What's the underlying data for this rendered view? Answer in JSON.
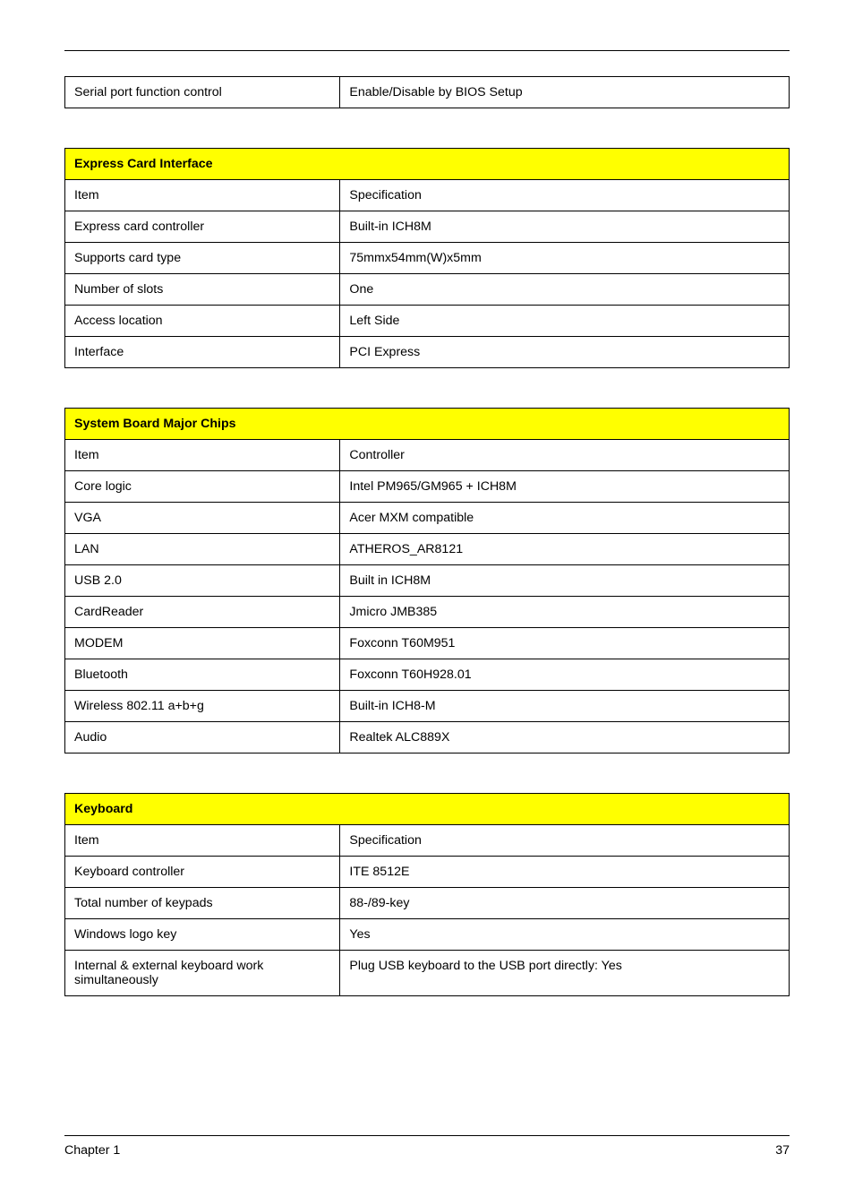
{
  "topRow": {
    "item": "Serial port function control",
    "spec": "Enable/Disable by BIOS Setup"
  },
  "tables": [
    {
      "title": "Express Card Interface",
      "headers": [
        "Item",
        "Specification"
      ],
      "rows": [
        [
          "Express card controller",
          "Built-in ICH8M"
        ],
        [
          "Supports card type",
          "75mmx54mm(W)x5mm"
        ],
        [
          "Number of slots",
          "One"
        ],
        [
          "Access location",
          "Left Side"
        ],
        [
          "Interface",
          "PCI Express"
        ]
      ]
    },
    {
      "title": "System Board Major Chips",
      "headers": [
        "Item",
        "Controller"
      ],
      "rows": [
        [
          "Core logic",
          "Intel PM965/GM965 + ICH8M"
        ],
        [
          "VGA",
          "Acer MXM compatible"
        ],
        [
          "LAN",
          "ATHEROS_AR8121"
        ],
        [
          "USB 2.0",
          "Built in ICH8M"
        ],
        [
          "CardReader",
          "Jmicro JMB385"
        ],
        [
          "MODEM",
          "Foxconn T60M951"
        ],
        [
          "Bluetooth",
          "Foxconn T60H928.01"
        ],
        [
          "Wireless 802.11 a+b+g",
          "Built-in ICH8-M"
        ],
        [
          "Audio",
          "Realtek ALC889X"
        ]
      ]
    },
    {
      "title": "Keyboard",
      "headers": [
        "Item",
        "Specification"
      ],
      "rows": [
        [
          "Keyboard controller",
          "ITE 8512E"
        ],
        [
          "Total number of keypads",
          "88-/89-key"
        ],
        [
          "Windows logo key",
          "Yes"
        ],
        [
          "Internal & external keyboard work simultaneously",
          "Plug USB keyboard to the USB port directly: Yes"
        ]
      ]
    }
  ],
  "footer": {
    "left": "Chapter 1",
    "right": "37"
  }
}
